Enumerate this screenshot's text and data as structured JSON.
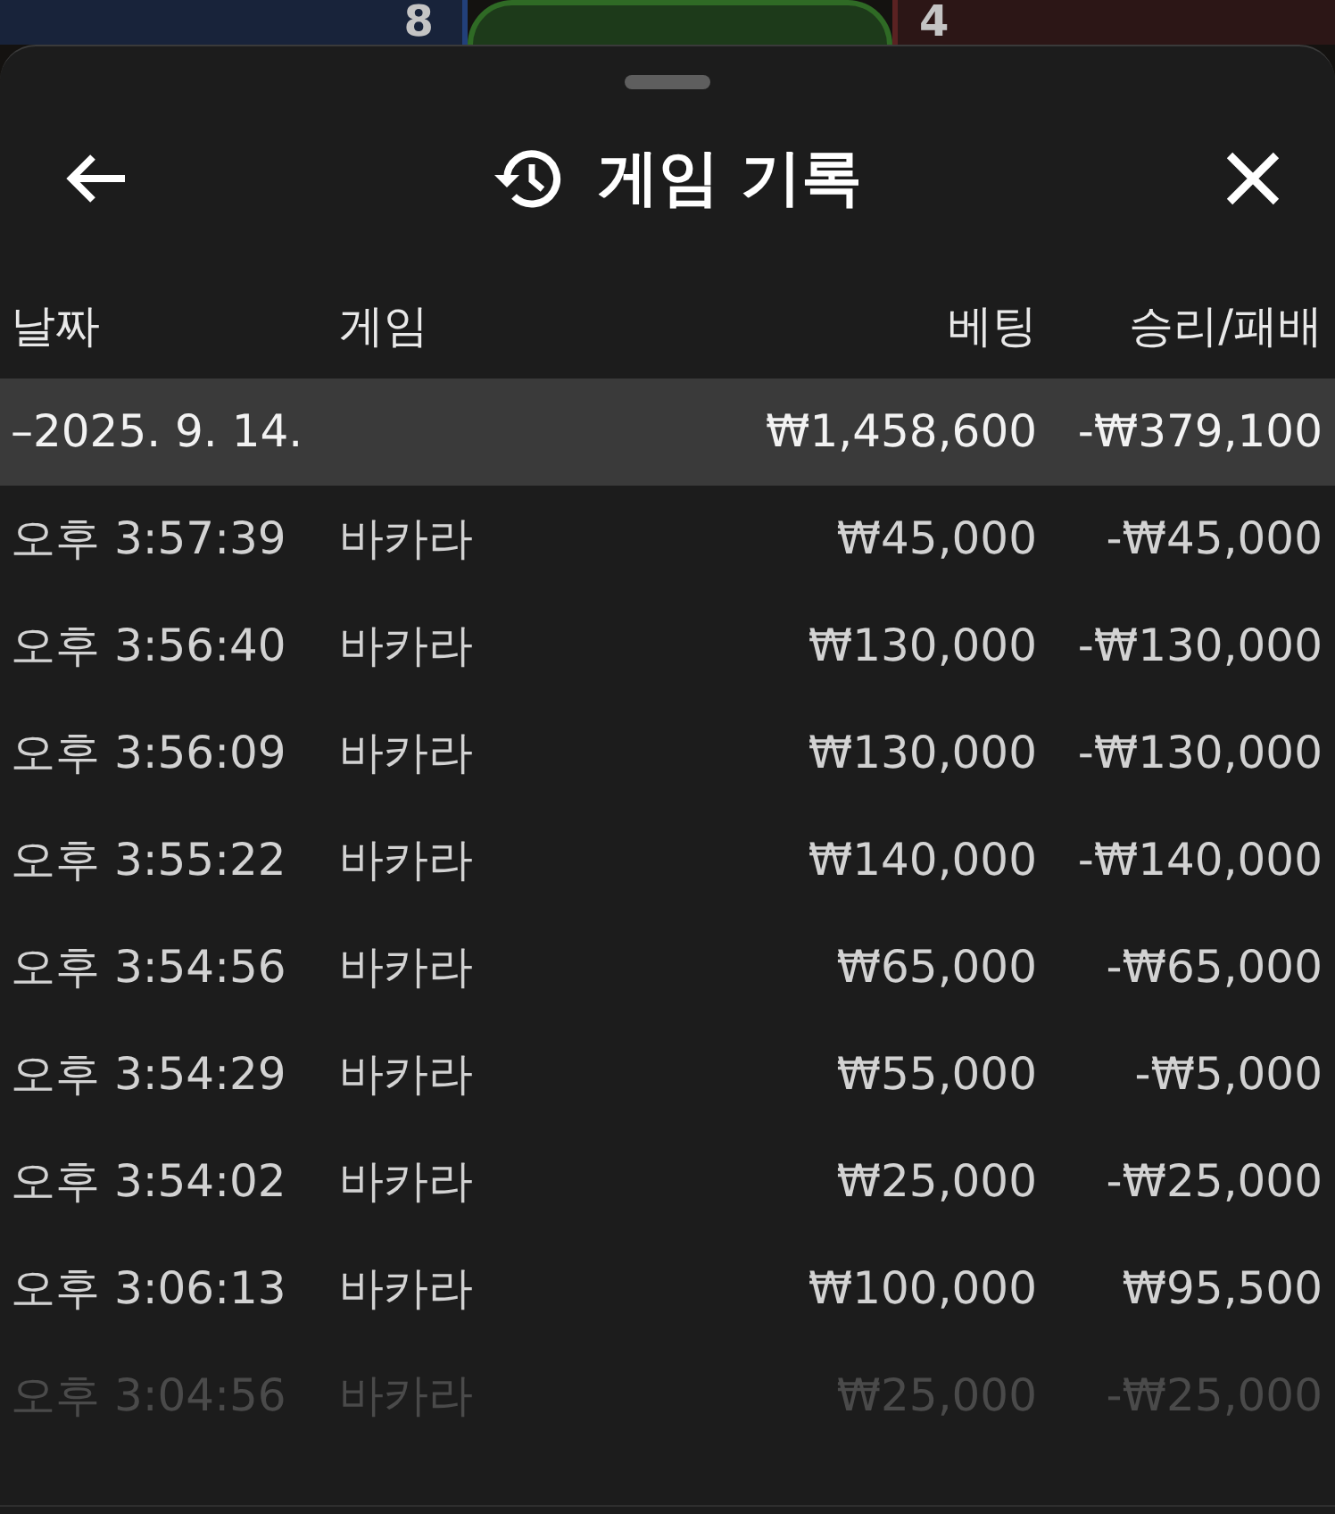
{
  "background": {
    "numbers": [
      "8",
      "4"
    ]
  },
  "sheet": {
    "title": "게임 기록"
  },
  "table": {
    "columns": [
      "날짜",
      "게임",
      "베팅",
      "승리/패배"
    ],
    "group": {
      "date": "–2025. 9. 14.",
      "bet": "₩1,458,600",
      "result": "-₩379,100",
      "expanded": true
    },
    "rows": [
      {
        "time": "오후 3:57:39",
        "game": "바카라",
        "bet": "₩45,000",
        "result": "-₩45,000",
        "faded": false
      },
      {
        "time": "오후 3:56:40",
        "game": "바카라",
        "bet": "₩130,000",
        "result": "-₩130,000",
        "faded": false
      },
      {
        "time": "오후 3:56:09",
        "game": "바카라",
        "bet": "₩130,000",
        "result": "-₩130,000",
        "faded": false
      },
      {
        "time": "오후 3:55:22",
        "game": "바카라",
        "bet": "₩140,000",
        "result": "-₩140,000",
        "faded": false
      },
      {
        "time": "오후 3:54:56",
        "game": "바카라",
        "bet": "₩65,000",
        "result": "-₩65,000",
        "faded": false
      },
      {
        "time": "오후 3:54:29",
        "game": "바카라",
        "bet": "₩55,000",
        "result": "-₩5,000",
        "faded": false
      },
      {
        "time": "오후 3:54:02",
        "game": "바카라",
        "bet": "₩25,000",
        "result": "-₩25,000",
        "faded": false
      },
      {
        "time": "오후 3:06:13",
        "game": "바카라",
        "bet": "₩100,000",
        "result": "₩95,500",
        "faded": false
      },
      {
        "time": "오후 3:04:56",
        "game": "바카라",
        "bet": "₩25,000",
        "result": "-₩25,000",
        "faded": true
      }
    ]
  }
}
